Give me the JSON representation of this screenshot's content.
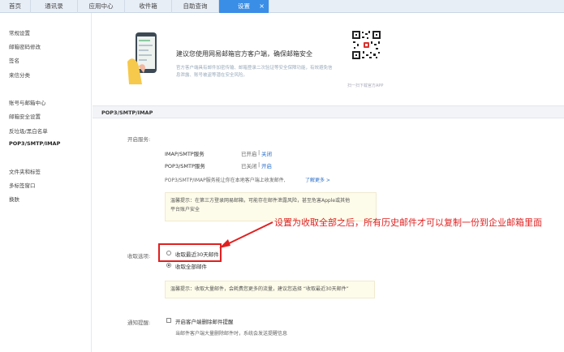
{
  "tabs": [
    {
      "label": "首页"
    },
    {
      "label": "通讯录"
    },
    {
      "label": "应用中心"
    },
    {
      "label": "收件箱"
    },
    {
      "label": "自助查询"
    },
    {
      "label": "设置",
      "close": "×"
    }
  ],
  "sidebar": {
    "groups": [
      [
        "常规设置",
        "邮箱密码修改",
        "签名",
        "来信分类"
      ],
      [
        "账号与邮箱中心",
        "邮箱安全设置",
        "反垃圾/黑白名单",
        "POP3/SMTP/IMAP"
      ],
      [
        "文件夹和标签",
        "多标签窗口",
        "换肤"
      ]
    ],
    "active": "POP3/SMTP/IMAP"
  },
  "promo": {
    "title": "建议您使用网易邮箱官方客户端，确保邮箱安全",
    "desc": "官方客户端具有邮件加密传输、邮箱登录二次验证等安全保障功能，有效避免信息泄露、账号被盗等潜在安全风险。",
    "qr_caption": "扫一扫下载官方APP"
  },
  "section": {
    "title": "POP3/SMTP/IMAP"
  },
  "services": {
    "label": "开启服务:",
    "rows": [
      {
        "name": "IMAP/SMTP服务",
        "status": "已开启",
        "sep": "|",
        "action": "关闭"
      },
      {
        "name": "POP3/SMTP服务",
        "status": "已关闭",
        "sep": "|",
        "action": "开启"
      }
    ],
    "note": "POP3/SMTP/IMAP服务能让你在本地客户端上收发邮件,",
    "learn_more": "了解更多 >"
  },
  "warning1": {
    "line1": "温馨提示：在第三方登录网易邮箱，可能存在邮件泄露风险，甚至危害Apple或其他",
    "line2": "平台账户安全"
  },
  "receive": {
    "label": "收取选项:",
    "options": [
      {
        "label": "收取最近30天邮件",
        "selected": false
      },
      {
        "label": "收取全部邮件",
        "selected": true
      }
    ]
  },
  "annotation": {
    "text": "设置为收取全部之后，所有历史邮件才可以复制一份到企业邮箱里面",
    "color": "#e02020"
  },
  "warning2": {
    "text": "温馨提示：收取大量邮件，会耗费您更多的流量，建议您选择 “收取最近30天邮件”"
  },
  "delete_alert": {
    "label": "通知提醒:",
    "checkbox_label": "开启客户端删除邮件提醒",
    "desc": "当邮件客户端大量删除邮件时，系统会发送提醒信息"
  },
  "colors": {
    "accent": "#3a8ee6",
    "link": "#2a6fc9",
    "annotation": "#e02020",
    "notice_bg": "#fdfbe9"
  }
}
